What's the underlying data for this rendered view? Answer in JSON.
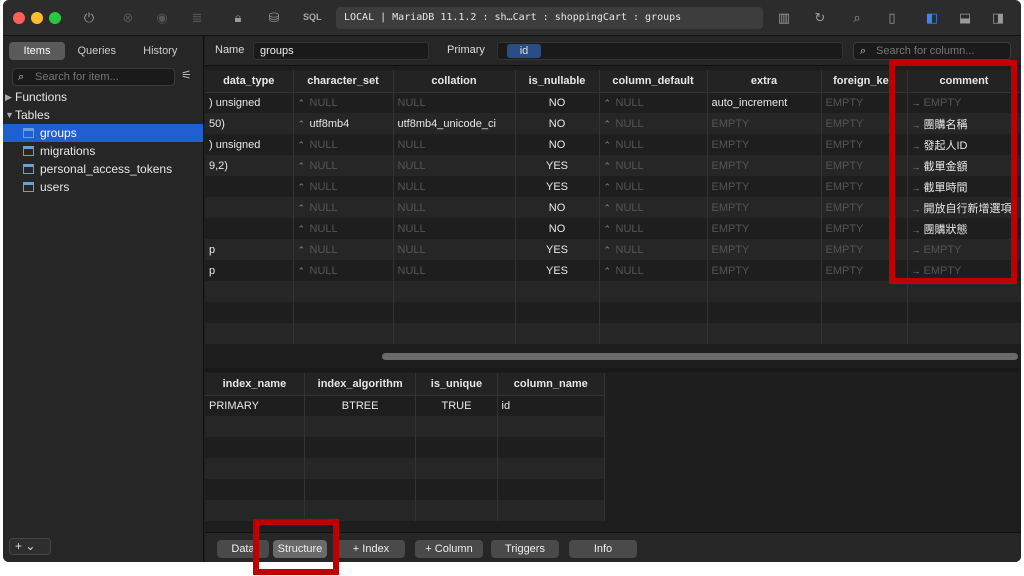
{
  "address": "LOCAL | MariaDB 11.1.2 : sh…Cart : shoppingCart : groups",
  "toolbar": {
    "sql_label": "SQL"
  },
  "sidebar": {
    "tabs": [
      "Items",
      "Queries",
      "History"
    ],
    "search_placeholder": "Search for item...",
    "tree": [
      {
        "label": "Functions",
        "kind": "group"
      },
      {
        "label": "Tables",
        "kind": "group"
      },
      {
        "label": "groups",
        "kind": "table",
        "selected": true
      },
      {
        "label": "migrations",
        "kind": "table"
      },
      {
        "label": "personal_access_tokens",
        "kind": "table"
      },
      {
        "label": "users",
        "kind": "table"
      }
    ],
    "add_label": "+ ⌄"
  },
  "props": {
    "name_label": "Name",
    "name_value": "groups",
    "primary_label": "Primary",
    "primary_value": "id",
    "column_search_placeholder": "Search for column..."
  },
  "columns_table": {
    "headers": [
      "data_type",
      "character_set",
      "collation",
      "is_nullable",
      "column_default",
      "extra",
      "foreign_key",
      "comment"
    ],
    "rows": [
      [
        ") unsigned",
        "NULL",
        "NULL",
        "NO",
        "NULL",
        "auto_increment",
        "EMPTY",
        "EMPTY"
      ],
      [
        "50)",
        "utf8mb4",
        "utf8mb4_unicode_ci",
        "NO",
        "NULL",
        "EMPTY",
        "EMPTY",
        "團購名稱"
      ],
      [
        ") unsigned",
        "NULL",
        "NULL",
        "NO",
        "NULL",
        "EMPTY",
        "EMPTY",
        "發起人ID"
      ],
      [
        "9,2)",
        "NULL",
        "NULL",
        "YES",
        "NULL",
        "EMPTY",
        "EMPTY",
        "截單金額"
      ],
      [
        "",
        "NULL",
        "NULL",
        "YES",
        "NULL",
        "EMPTY",
        "EMPTY",
        "截單時間"
      ],
      [
        "",
        "NULL",
        "NULL",
        "NO",
        "NULL",
        "EMPTY",
        "EMPTY",
        "開放自行新增選項"
      ],
      [
        "",
        "NULL",
        "NULL",
        "NO",
        "NULL",
        "EMPTY",
        "EMPTY",
        "團購狀態"
      ],
      [
        "p",
        "NULL",
        "NULL",
        "YES",
        "NULL",
        "EMPTY",
        "EMPTY",
        "EMPTY"
      ],
      [
        "p",
        "NULL",
        "NULL",
        "YES",
        "NULL",
        "EMPTY",
        "EMPTY",
        "EMPTY"
      ]
    ]
  },
  "index_table": {
    "headers": [
      "index_name",
      "index_algorithm",
      "is_unique",
      "column_name"
    ],
    "rows": [
      [
        "PRIMARY",
        "BTREE",
        "TRUE",
        "id"
      ]
    ]
  },
  "bottom_tabs": [
    "Data",
    "Structure",
    "+ Index",
    "+ Column",
    "Triggers",
    "Info"
  ]
}
